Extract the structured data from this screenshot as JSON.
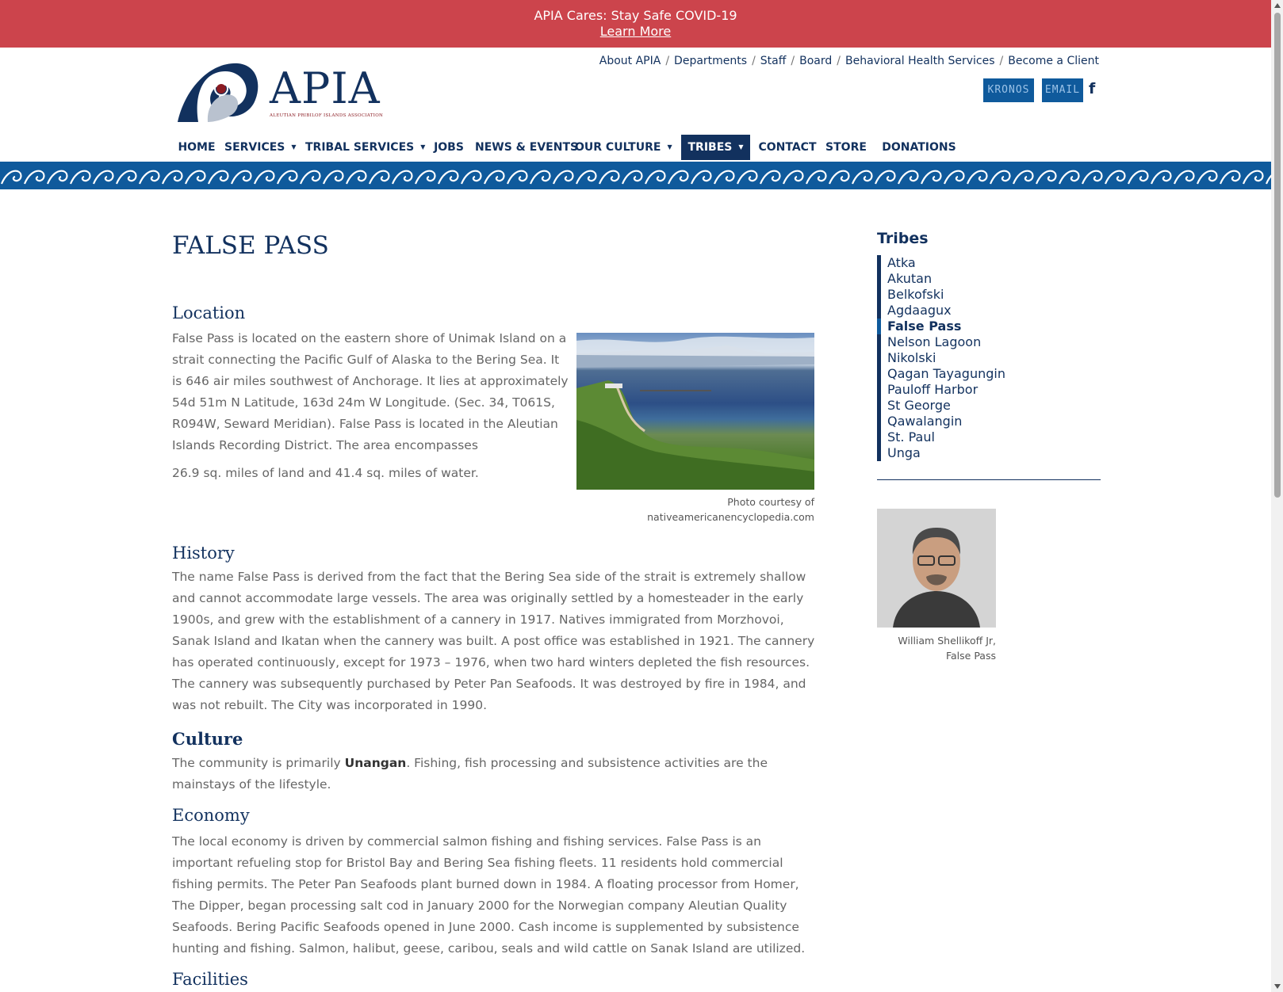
{
  "alert": {
    "text": "APIA Cares: Stay Safe COVID-19",
    "link": "Learn More"
  },
  "logo": {
    "brand": "APIA",
    "subtitle": "ALEUTIAN PRIBILOF ISLANDS ASSOCIATION"
  },
  "utility_nav": [
    "About APIA",
    "Departments",
    "Staff",
    "Board",
    "Behavioral Health Services",
    "Become a Client"
  ],
  "quick_buttons": {
    "kronos": "KRONOS",
    "email": "EMAIL",
    "facebook": "f"
  },
  "main_nav": [
    {
      "label": "HOME"
    },
    {
      "label": "SERVICES",
      "has_dropdown": true
    },
    {
      "label": "TRIBAL SERVICES",
      "has_dropdown": true
    },
    {
      "label": "JOBS"
    },
    {
      "label": "NEWS & EVENTS"
    },
    {
      "label": "OUR CULTURE",
      "has_dropdown": true
    },
    {
      "label": "TRIBES",
      "has_dropdown": true,
      "active": true
    },
    {
      "label": "CONTACT"
    },
    {
      "label": "STORE"
    },
    {
      "label": "DONATIONS"
    }
  ],
  "page": {
    "title": "FALSE PASS",
    "location_heading": "Location",
    "location_text": "False Pass is located on the eastern shore of Unimak Island on a strait connecting the Pacific Gulf of Alaska to the Bering Sea. It is 646 air miles southwest of Anchorage. It lies at approximately 54d 51m N Latitude, 163d 24m W Longitude. (Sec. 34, T061S, R094W, Seward Meridian). False Pass is located in the Aleutian Islands Recording District. The area encompasses",
    "location_text2": "26.9 sq. miles of land and 41.4 sq. miles of water.",
    "photo_caption_1": "Photo courtesy of",
    "photo_caption_2": "nativeamericanencyclopedia.com",
    "history_heading": "History",
    "history_text": "The name False Pass is derived from the fact that the Bering Sea side of the strait is extremely shallow and cannot accommodate large vessels. The area was originally settled by a homesteader in the early 1900s, and grew with the establishment of a cannery in 1917. Natives immigrated from Morzhovoi, Sanak Island and Ikatan when the cannery was built. A post office was established in 1921. The cannery has operated continuously, except for 1973 – 1976, when two hard winters depleted the fish resources. The cannery was subsequently purchased by Peter Pan Seafoods. It was destroyed by fire in 1984, and was not rebuilt. The City was incorporated in 1990.",
    "culture_heading": "Culture",
    "culture_text_pre": "The community is primarily ",
    "culture_text_bold": "Unangan",
    "culture_text_post": ". Fishing, fish processing and subsistence activities are the mainstays of the lifestyle.",
    "economy_heading": "Economy",
    "economy_text": "The local economy is driven by commercial salmon fishing and fishing services. False Pass is an important refueling stop for Bristol Bay and Bering Sea fishing fleets. 11 residents hold commercial fishing permits. The Peter Pan Seafoods plant burned down in 1984. A floating processor from Homer, The Dipper, began processing salt cod in January 2000 for the Norwegian company Aleutian Quality Seafoods. Bering Pacific Seafoods opened in June 2000. Cash income is supplemented by subsistence hunting and fishing. Salmon, halibut, geese, caribou, seals and wild cattle on Sanak Island are utilized.",
    "facilities_heading": "Facilities"
  },
  "sidebar": {
    "title": "Tribes",
    "tribes": [
      "Atka",
      "Akutan",
      "Belkofski",
      "Agdaagux",
      "False Pass",
      "Nelson Lagoon",
      "Nikolski",
      "Qagan Tayagungin",
      "Pauloff Harbor",
      "St George",
      "Qawalangin",
      "St. Paul",
      "Unga"
    ],
    "current": "False Pass",
    "portrait_caption_1": "William Shellikoff Jr,",
    "portrait_caption_2": "False Pass"
  },
  "colors": {
    "alert_bg": "#cc444c",
    "brand_navy": "#12315e",
    "brand_blue": "#0f5a9c"
  }
}
